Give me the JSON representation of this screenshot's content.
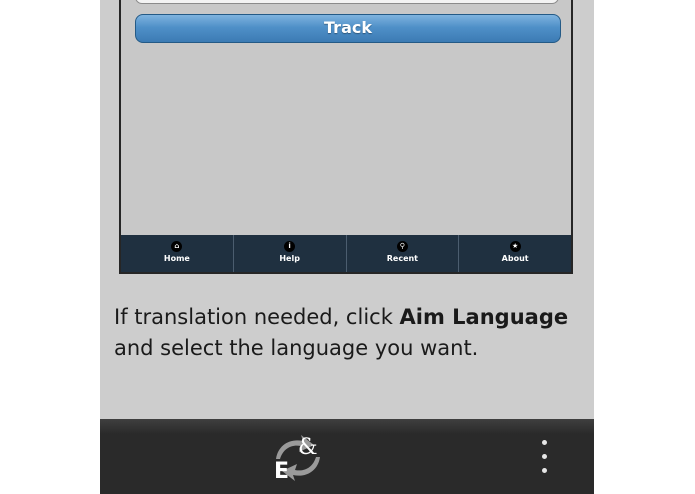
{
  "app": {
    "track_button_label": "Track"
  },
  "navbar": {
    "items": [
      {
        "label": "Home",
        "icon": "home-icon",
        "glyph": "⌂"
      },
      {
        "label": "Help",
        "icon": "info-icon",
        "glyph": "i"
      },
      {
        "label": "Recent",
        "icon": "search-icon",
        "glyph": "⚲"
      },
      {
        "label": "About",
        "icon": "star-icon",
        "glyph": "★"
      }
    ]
  },
  "instruction": {
    "line1_prefix": "If translation needed, click ",
    "line1_bold": "Aim Language",
    "line2": "and select the language you want."
  },
  "bottom_bar": {
    "app_icon": "translate-app-icon",
    "menu_icon": "more-vertical-icon"
  },
  "colors": {
    "track_button": "#4f90c8",
    "navbar": "#1f3040",
    "bottom_bar": "#2a2a2a"
  }
}
